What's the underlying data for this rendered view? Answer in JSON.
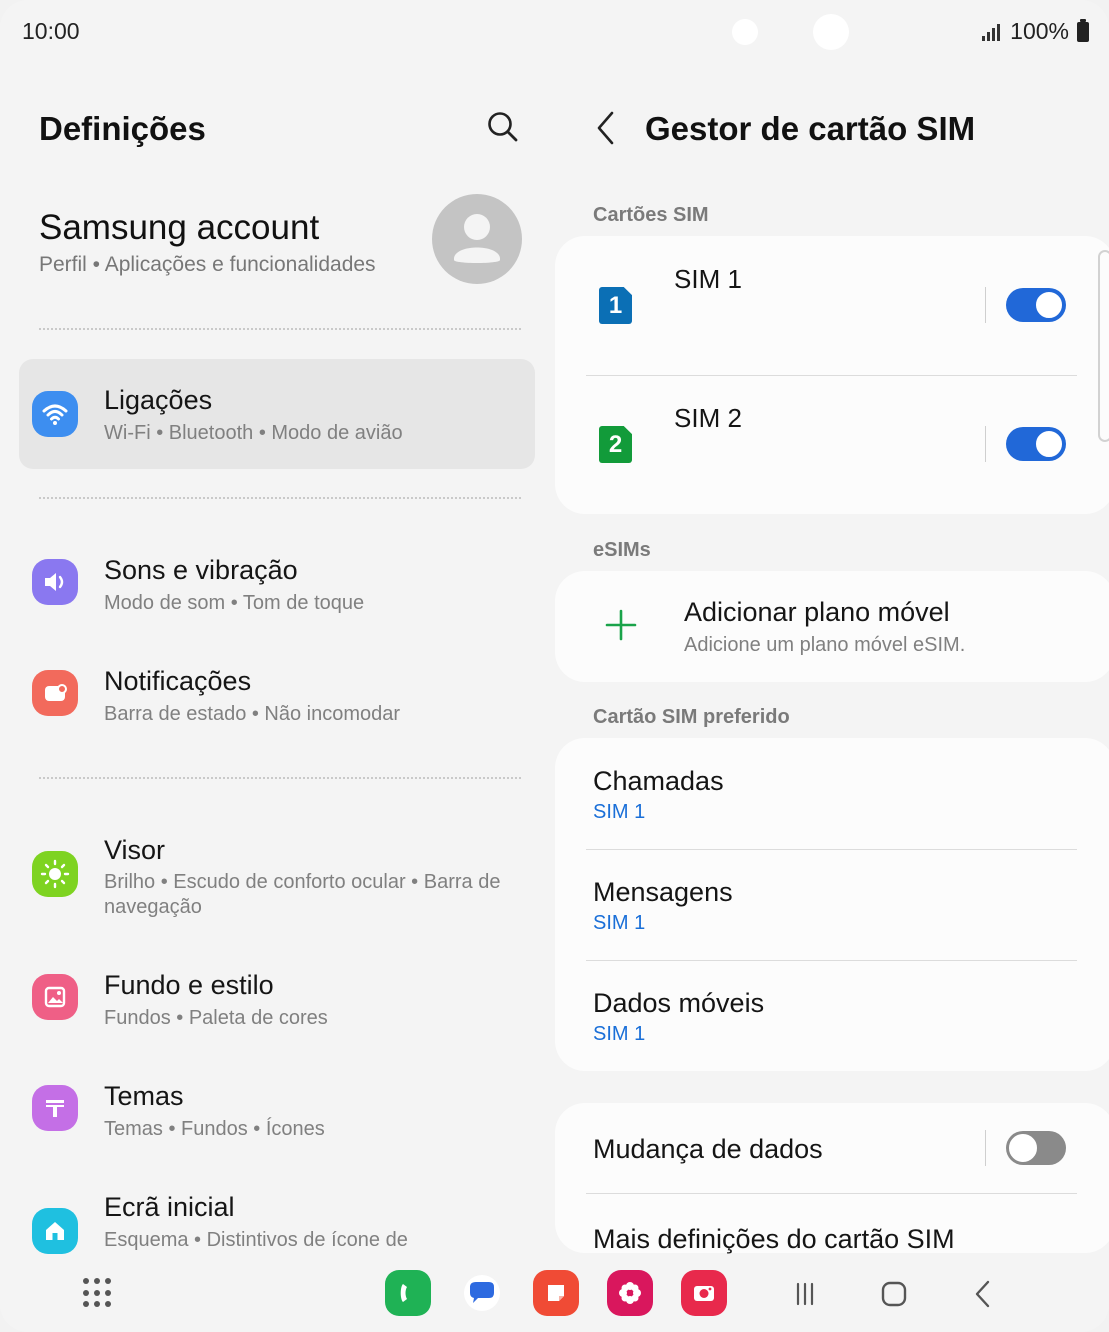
{
  "status": {
    "time": "10:00",
    "battery": "100%"
  },
  "left": {
    "title": "Definições",
    "account": {
      "title": "Samsung account",
      "subtitle": "Perfil  •  Aplicações e funcionalidades"
    },
    "items": [
      {
        "title": "Ligações",
        "subtitle": "Wi-Fi  •  Bluetooth  •  Modo de avião",
        "icon": "wifi-icon",
        "color": "#3d8ef0"
      },
      {
        "title": "Sons e vibração",
        "subtitle": "Modo de som  •  Tom de toque",
        "icon": "sound-icon",
        "color": "#8a78f0"
      },
      {
        "title": "Notificações",
        "subtitle": "Barra de estado  •  Não incomodar",
        "icon": "notification-icon",
        "color": "#f26a5c"
      },
      {
        "title": "Visor",
        "subtitle": "Brilho  •  Escudo de conforto ocular  •  Barra de navegação",
        "icon": "brightness-icon",
        "color": "#7ed321"
      },
      {
        "title": "Fundo e estilo",
        "subtitle": "Fundos  •  Paleta de cores",
        "icon": "wallpaper-icon",
        "color": "#ef5f86"
      },
      {
        "title": "Temas",
        "subtitle": "Temas  •  Fundos  •  Ícones",
        "icon": "themes-icon",
        "color": "#c46fe6"
      },
      {
        "title": "Ecrã inicial",
        "subtitle": "Esquema  •  Distintivos de ícone de",
        "icon": "home-icon",
        "color": "#1fc0e0"
      }
    ]
  },
  "right": {
    "title": "Gestor de cartão SIM",
    "sections": {
      "sim_cards": "Cartões SIM",
      "esims": "eSIMs",
      "preferred": "Cartão SIM preferido"
    },
    "sims": [
      {
        "badge": "1",
        "label": "SIM 1",
        "enabled": true,
        "color": "#0b6fb5"
      },
      {
        "badge": "2",
        "label": "SIM 2",
        "enabled": true,
        "color": "#129b3a"
      }
    ],
    "add_plan": {
      "title": "Adicionar plano móvel",
      "subtitle": "Adicione um plano móvel eSIM."
    },
    "preferred": [
      {
        "title": "Chamadas",
        "value": "SIM 1"
      },
      {
        "title": "Mensagens",
        "value": "SIM 1"
      },
      {
        "title": "Dados móveis",
        "value": "SIM 1"
      }
    ],
    "data_switch": {
      "title": "Mudança de dados",
      "enabled": false
    },
    "more": {
      "title": "Mais definições do cartão SIM"
    }
  },
  "dock": [
    "phone-app-icon",
    "messages-app-icon",
    "notes-app-icon",
    "gallery-app-icon",
    "camera-app-icon"
  ]
}
